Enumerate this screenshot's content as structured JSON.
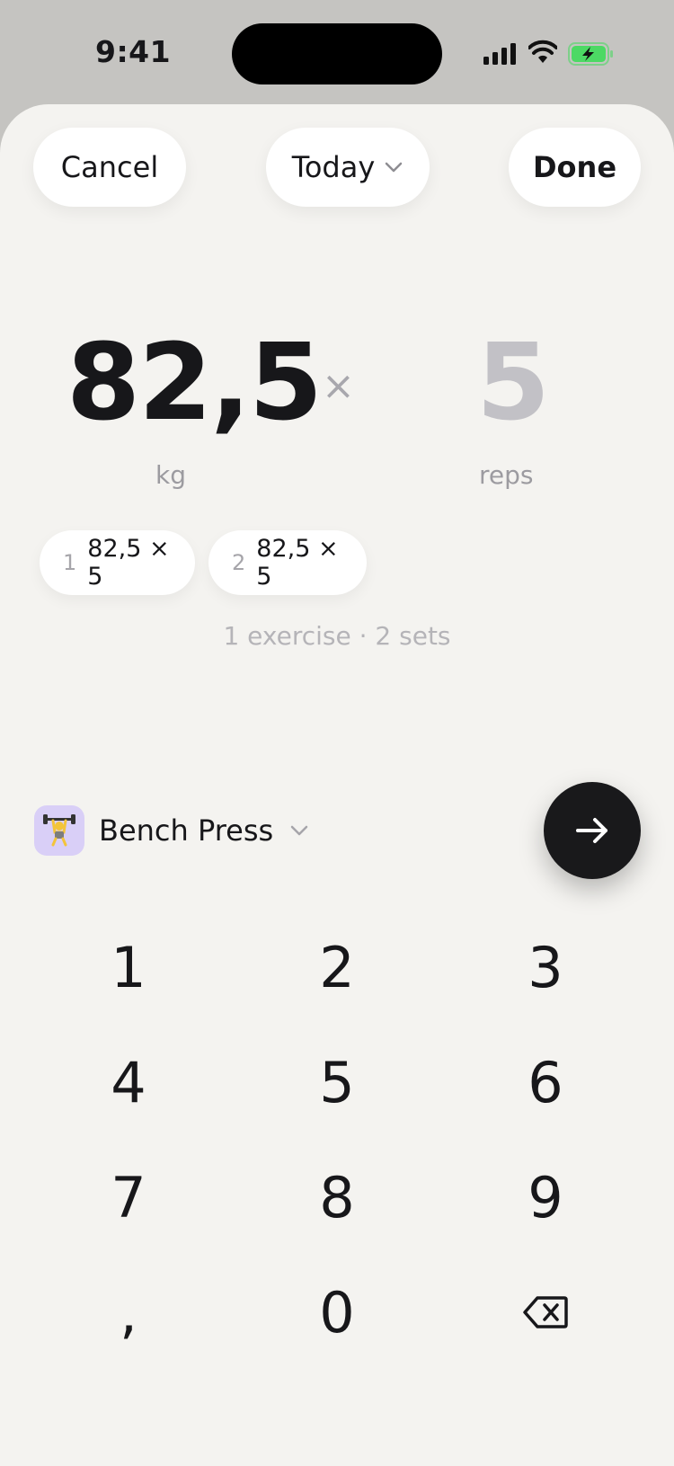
{
  "status_bar": {
    "time": "9:41"
  },
  "header": {
    "cancel_label": "Cancel",
    "date_label": "Today",
    "done_label": "Done"
  },
  "entry": {
    "weight": "82,5",
    "times": "×",
    "reps": "5",
    "weight_unit": "kg",
    "reps_unit": "reps"
  },
  "sets": [
    {
      "number": "1",
      "value": "82,5 × 5"
    },
    {
      "number": "2",
      "value": "82,5 × 5"
    }
  ],
  "summary": "1 exercise · 2 sets",
  "exercise": {
    "name": "Bench Press",
    "icon": "weightlifter-icon",
    "icon_bg": "#d9cff7"
  },
  "keypad": {
    "keys": [
      "1",
      "2",
      "3",
      "4",
      "5",
      "6",
      "7",
      "8",
      "9",
      ",",
      "0"
    ],
    "delete_icon": "backspace-icon"
  },
  "colors": {
    "accent_dark": "#19191b",
    "battery": "#4cd964",
    "muted": "#c2c1c6"
  }
}
